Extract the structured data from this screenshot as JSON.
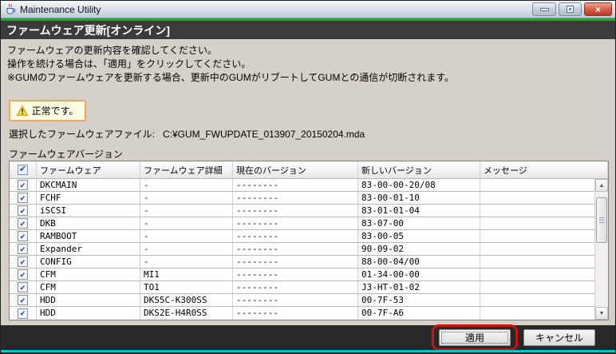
{
  "titlebar": {
    "title": "Maintenance Utility",
    "close_glyph": "×"
  },
  "page_header": {
    "title": "ファームウェア更新[オンライン]"
  },
  "instructions": {
    "line1": "ファームウェアの更新内容を確認してください。",
    "line2": "操作を続ける場合は、「適用」をクリックしてください。",
    "line3": "※GUMのファームウェアを更新する場合、更新中のGUMがリブートしてGUMとの通信が切断されます。"
  },
  "status": {
    "text": "正常です。"
  },
  "file_selection": {
    "label": "選択したファームウェアファイル:",
    "value": "C:¥GUM_FWUPDATE_013907_20150204.mda"
  },
  "firmware_table": {
    "section_label": "ファームウェアバージョン",
    "columns": [
      "ファームウェア",
      "ファームウェア詳細",
      "現在のバージョン",
      "新しいバージョン",
      "メッセージ"
    ],
    "rows": [
      {
        "checked": true,
        "firmware": "DKCMAIN",
        "detail": "-",
        "current": "--------",
        "new_version": "83-00-00-20/08",
        "message": ""
      },
      {
        "checked": true,
        "firmware": "FCHF",
        "detail": "-",
        "current": "--------",
        "new_version": "83-00-01-10",
        "message": ""
      },
      {
        "checked": true,
        "firmware": "iSCSI",
        "detail": "-",
        "current": "--------",
        "new_version": "83-01-01-04",
        "message": ""
      },
      {
        "checked": true,
        "firmware": "DKB",
        "detail": "-",
        "current": "--------",
        "new_version": "83-07-00",
        "message": ""
      },
      {
        "checked": true,
        "firmware": "RAMBOOT",
        "detail": "-",
        "current": "--------",
        "new_version": "83-00-05",
        "message": ""
      },
      {
        "checked": true,
        "firmware": "Expander",
        "detail": "-",
        "current": "--------",
        "new_version": "90-09-02",
        "message": ""
      },
      {
        "checked": true,
        "firmware": "CONFIG",
        "detail": "-",
        "current": "--------",
        "new_version": "88-00-04/00",
        "message": ""
      },
      {
        "checked": true,
        "firmware": "CFM",
        "detail": "MI1",
        "current": "--------",
        "new_version": "01-34-00-00",
        "message": ""
      },
      {
        "checked": true,
        "firmware": "CFM",
        "detail": "TO1",
        "current": "--------",
        "new_version": "J3-HT-01-02",
        "message": ""
      },
      {
        "checked": true,
        "firmware": "HDD",
        "detail": "DKS5C-K300SS",
        "current": "--------",
        "new_version": "00-7F-53",
        "message": ""
      },
      {
        "checked": true,
        "firmware": "HDD",
        "detail": "DKS2E-H4R0SS",
        "current": "--------",
        "new_version": "00-7F-A6",
        "message": ""
      }
    ]
  },
  "icons": {
    "check": "✔",
    "scroll_up": "▲",
    "scroll_down": "▼"
  },
  "footer": {
    "apply_label": "適用",
    "cancel_label": "キャンセル"
  },
  "colors": {
    "accent_green": "#00c000",
    "page_header_bg": "#3b3b3b",
    "content_bg": "#d5d1c9",
    "footer_bg": "#282828",
    "status_box_bg": "#fffce4",
    "status_box_border": "#f0a860",
    "annotation_red": "#c81414",
    "window_border_teal": "#00c8c8",
    "check_blue": "#1f4f9f"
  }
}
